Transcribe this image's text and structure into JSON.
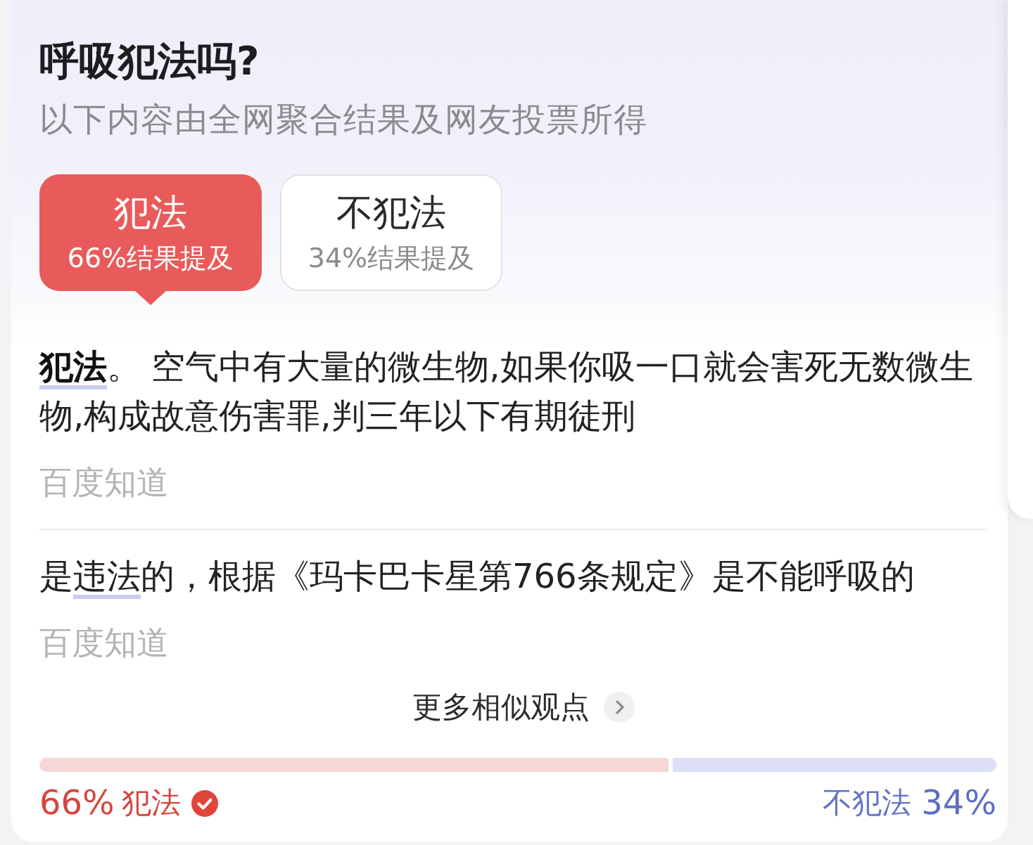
{
  "question": {
    "title": "呼吸犯法吗?",
    "subtitle": "以下内容由全网聚合结果及网友投票所得"
  },
  "options": [
    {
      "label": "犯法",
      "caption": "66%结果提及",
      "selected": true
    },
    {
      "label": "不犯法",
      "caption": "34%结果提及",
      "selected": false
    }
  ],
  "answers": [
    {
      "parts": [
        {
          "kind": "keyword",
          "text": "犯法"
        },
        {
          "kind": "plain",
          "text": "。 空气中有大量的微生物,如果你吸一口就会害死无数微生物,构成故意伤害罪,判三年以下有期徒刑"
        }
      ],
      "source": "百度知道"
    },
    {
      "parts": [
        {
          "kind": "plain",
          "text": "是"
        },
        {
          "kind": "link",
          "text": "违法"
        },
        {
          "kind": "plain",
          "text": "的，根据《玛卡巴卡星第766条规定》是不能呼吸的"
        }
      ],
      "source": "百度知道"
    }
  ],
  "more_link": "更多相似观点",
  "vote_bar": {
    "level": 0.66,
    "left_percent": "66%",
    "left_label": "犯法",
    "right_label": "不犯法",
    "right_percent": "34%"
  }
}
